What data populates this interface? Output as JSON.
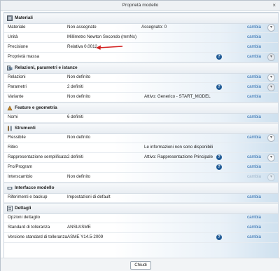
{
  "window": {
    "title": "Proprietà modello",
    "close_glyph": "×"
  },
  "sections": {
    "materiali": {
      "title": "Materiali"
    },
    "relazioni": {
      "title": "Relazioni, parametri e istanze"
    },
    "feature": {
      "title": "Feature e geometria"
    },
    "strumenti": {
      "title": "Strumenti"
    },
    "interfacce": {
      "title": "Interfacce modello"
    },
    "dettagli": {
      "title": "Dettagli"
    }
  },
  "rows": {
    "materiale": {
      "label": "Materiale",
      "value": "Non assegnato",
      "extra": "Assegnato: 0",
      "link": "cambia"
    },
    "unita": {
      "label": "Unità",
      "value": "Millimetro Newton Secondo (mmNs)",
      "link": "cambia"
    },
    "precisione": {
      "label": "Precisione",
      "value": "Relativa 0.0012",
      "link": "cambia"
    },
    "proprieta_massa": {
      "label": "Proprietà massa",
      "link": "cambia"
    },
    "relazioni": {
      "label": "Relazioni",
      "value": "Non definito",
      "link": "cambia"
    },
    "parametri": {
      "label": "Parametri",
      "value": "2 definiti",
      "link": "cambia"
    },
    "varianti": {
      "label": "Variante",
      "value": "Non definito",
      "extra": "Attivo: Generico - START_MODEL",
      "link": "cambia"
    },
    "nomi": {
      "label": "Nomi",
      "value": "6 definiti",
      "link": "cambia"
    },
    "flessibile": {
      "label": "Flessibile",
      "value": "Non definito",
      "link": "cambia"
    },
    "ritiro": {
      "label": "Ritiro",
      "extra": "Le informazioni non sono disponibili"
    },
    "rappresentazione": {
      "label": "Rappresentazione semplificata",
      "value": "2 definiti",
      "extra": "Attivo: Rappresentazione Principale",
      "link": "cambia"
    },
    "proprogram": {
      "label": "Pro/Program",
      "link": "cambia"
    },
    "interscambio": {
      "label": "Interscambio",
      "value": "Non definito",
      "link": "cambia"
    },
    "riferimenti": {
      "label": "Riferimenti e backup",
      "value": "Impostazioni di default",
      "link": "cambia"
    },
    "opzioni_dettaglio": {
      "label": "Opzioni dettaglio",
      "link": "cambia"
    },
    "standard_tolleranza": {
      "label": "Standard di tolleranza",
      "value": "ANSI/ASME",
      "link": "cambia"
    },
    "versione_tolleranza": {
      "label": "Versione standard di tolleranza",
      "value": "ASME Y14.5-2009",
      "link": "cambia"
    }
  },
  "icons": {
    "help": "help-icon",
    "expand": "chevron-down-icon",
    "arrow_color": "#d32020",
    "link_color": "#2b6cb0"
  },
  "footer": {
    "close_label": "Chiudi"
  }
}
